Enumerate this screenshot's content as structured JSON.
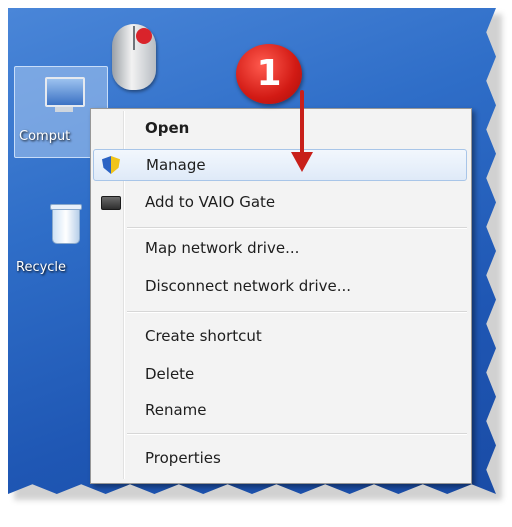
{
  "desktop": {
    "icons": [
      {
        "label": "Comput",
        "icon": "computer-icon"
      },
      {
        "label": "Recycle",
        "icon": "recycle-bin-icon"
      }
    ],
    "background_color": "#2f6ec8"
  },
  "annotation": {
    "step_number": "1",
    "badge_color": "#d21a14"
  },
  "context_menu": {
    "items": [
      {
        "label": "Open",
        "bold": true
      },
      {
        "label": "Manage",
        "icon": "admin-shield-icon",
        "highlighted": true
      },
      {
        "label": "Add to VAIO Gate",
        "icon": "vaio-gate-icon"
      },
      {
        "label": "Map network drive..."
      },
      {
        "label": "Disconnect network drive..."
      },
      {
        "label": "Create shortcut"
      },
      {
        "label": "Delete"
      },
      {
        "label": "Rename"
      },
      {
        "label": "Properties"
      }
    ]
  }
}
